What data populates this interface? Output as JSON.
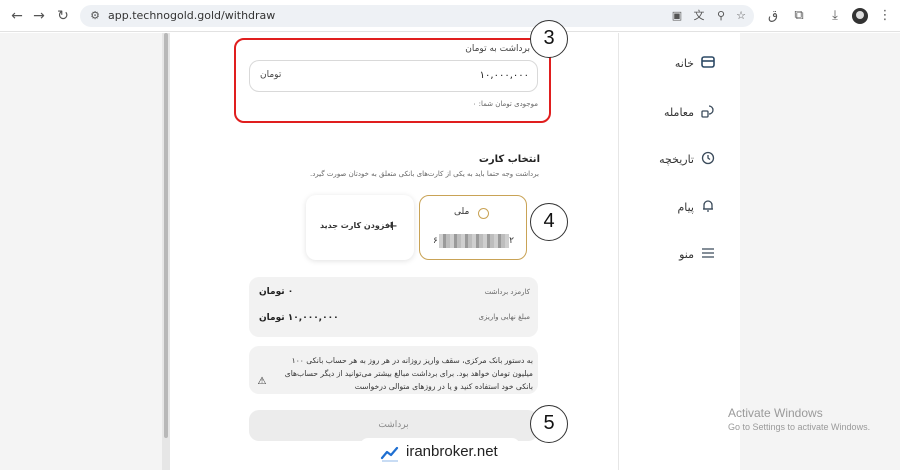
{
  "browser": {
    "url": "app.technogold.gold/withdraw"
  },
  "sidebar": {
    "items": [
      {
        "label": "خانه",
        "icon": "wallet-icon"
      },
      {
        "label": "معامله",
        "icon": "trade-icon"
      },
      {
        "label": "تاریخچه",
        "icon": "history-icon"
      },
      {
        "label": "پیام",
        "icon": "bell-icon"
      },
      {
        "label": "منو",
        "icon": "menu-icon"
      }
    ]
  },
  "payment": {
    "label": "برداشت به تومان",
    "amount": "۱۰,۰۰۰,۰۰۰",
    "unit": "تومان",
    "balance": "موجودی تومان شما: ۰"
  },
  "card_select": {
    "title": "انتخاب کارت",
    "subtitle": "برداشت وجه حتما باید به یکی از کارت‌های بانکی متعلق به خودتان صورت گیرد.",
    "selected_card": {
      "bank": "ملی",
      "number_start": "۶",
      "number_end": "۲"
    },
    "add_card_label": "افزودن کارت جدید"
  },
  "summary": {
    "fee_label": "کارمزد برداشت",
    "fee_value": "۰ تومان",
    "final_label": "مبلغ نهایی واریزی",
    "final_value": "۱۰,۰۰۰,۰۰۰ تومان"
  },
  "notice": {
    "text": "به دستور بانک مرکزی، سقف واریز روزانه در هر روز به هر حساب بانکی ۱۰۰ میلیون تومان خواهد بود. برای برداشت مبالغ بیشتر می‌توانید از دیگر حساب‌های بانکی خود استفاده کنید و یا در روزهای متوالی درخواست"
  },
  "withdraw_button": {
    "label": "برداشت"
  },
  "annotations": {
    "step3": "3",
    "step4": "4",
    "step5": "5"
  },
  "watermark": {
    "text": "iranbroker.net"
  },
  "os_overlay": {
    "title": "Activate Windows",
    "subtitle": "Go to Settings to activate Windows."
  },
  "colors": {
    "highlight": "#e01e1e",
    "card_border": "#c9a356"
  }
}
